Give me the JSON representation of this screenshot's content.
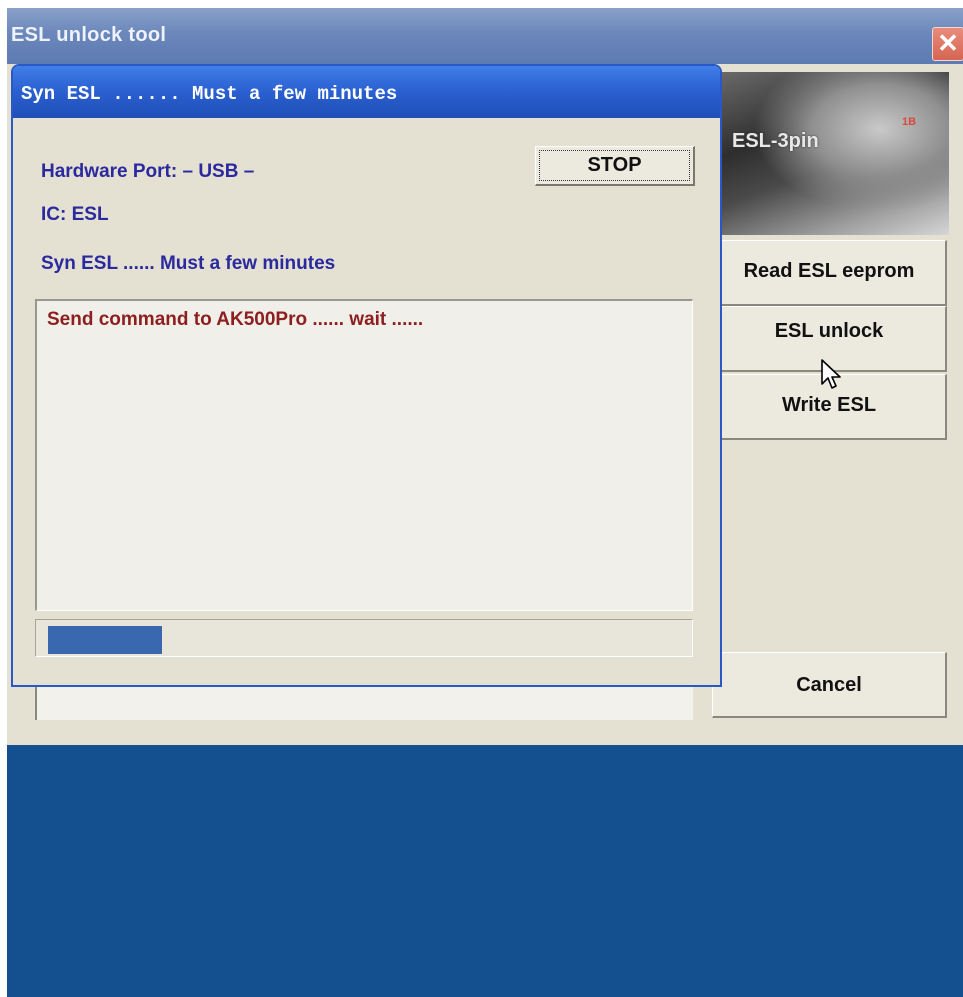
{
  "window": {
    "title": "ESL unlock tool",
    "close_glyph": "✕"
  },
  "device_image": {
    "label": "ESL-3pin",
    "tag": "1B"
  },
  "side_buttons": {
    "read": "Read ESL eeprom",
    "unlock": "ESL unlock",
    "write": "Write ESL",
    "cancel": "Cancel"
  },
  "dialog": {
    "title": "Syn ESL ...... Must a few minutes",
    "hardware_port": "Hardware Port: – USB –",
    "ic": "IC: ESL",
    "status": "Syn ESL ...... Must a few minutes",
    "stop_label": "STOP",
    "log_text": "Send command to AK500Pro ...... wait ......",
    "progress_fraction": 0.18
  },
  "colors": {
    "dialog_titlebar": "#2a5fcf",
    "info_text": "#2a2a9e",
    "log_text": "#8d1f1f",
    "progress_fill": "#3a68b0",
    "desktop": "#144f8f"
  },
  "icons": {
    "close": "close-icon",
    "cursor": "mouse-pointer-icon"
  }
}
